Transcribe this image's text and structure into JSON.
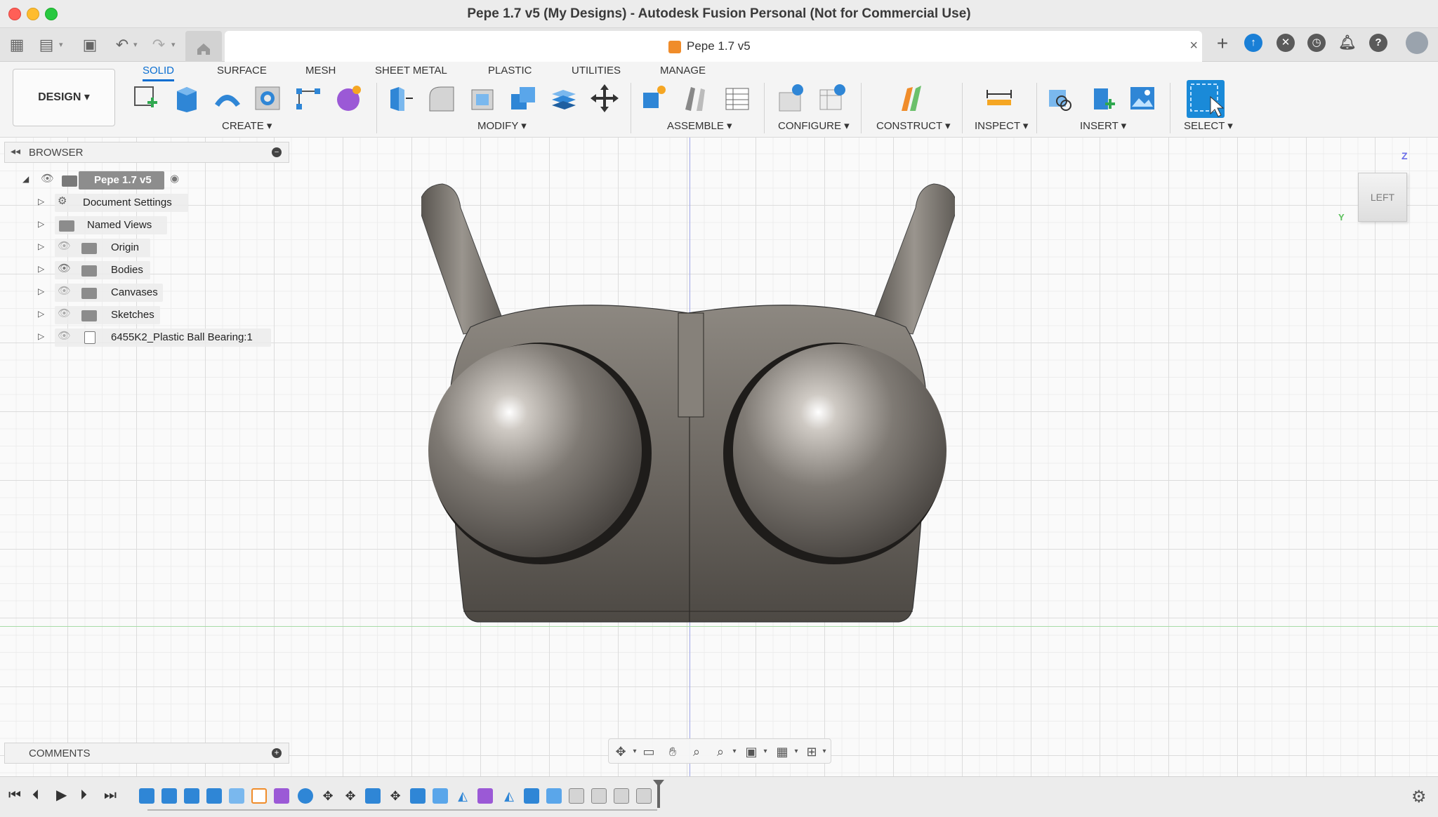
{
  "window": {
    "title": "Pepe 1.7 v5 (My Designs) - Autodesk Fusion Personal (Not for Commercial Use)"
  },
  "document_tab": {
    "title": "Pepe 1.7 v5",
    "close": "×"
  },
  "quick_access": {
    "grid_icon": "▦",
    "file_icon": "▤",
    "save_icon": "▣",
    "undo_icon": "↶",
    "redo_icon": "↷",
    "plus": "+"
  },
  "workspace": {
    "label": "DESIGN ▾"
  },
  "ribbon_tabs": [
    {
      "label": "SOLID",
      "active": true
    },
    {
      "label": "SURFACE"
    },
    {
      "label": "MESH"
    },
    {
      "label": "SHEET METAL"
    },
    {
      "label": "PLASTIC"
    },
    {
      "label": "UTILITIES"
    },
    {
      "label": "MANAGE"
    }
  ],
  "ribbon_groups": [
    {
      "label": "CREATE ▾"
    },
    {
      "label": "MODIFY ▾"
    },
    {
      "label": "ASSEMBLE ▾"
    },
    {
      "label": "CONFIGURE ▾"
    },
    {
      "label": "CONSTRUCT ▾"
    },
    {
      "label": "INSPECT ▾"
    },
    {
      "label": "INSERT ▾"
    },
    {
      "label": "SELECT ▾"
    }
  ],
  "browser": {
    "title": "BROWSER",
    "back": "◂◂",
    "collapse": "–",
    "root": "Pepe 1.7 v5",
    "items": [
      {
        "label": "Document Settings"
      },
      {
        "label": "Named Views"
      },
      {
        "label": "Origin"
      },
      {
        "label": "Bodies"
      },
      {
        "label": "Canvases"
      },
      {
        "label": "Sketches"
      },
      {
        "label": "6455K2_Plastic Ball Bearing:1"
      }
    ]
  },
  "viewcube": {
    "face": "LEFT",
    "z": "Z",
    "y": "Y"
  },
  "comments": {
    "title": "COMMENTS",
    "add": "+"
  },
  "colors": {
    "accent": "#0a6ed1",
    "body_dark": "#4a4642",
    "body_light": "#cfcac4",
    "axis_z": "#9fa6e8",
    "axis_y": "#a7dca6"
  },
  "timeline": {
    "first": "⏮",
    "prev": "⏴",
    "play": "▶",
    "next": "⏵",
    "last": "⏭",
    "settings": "⚙"
  }
}
